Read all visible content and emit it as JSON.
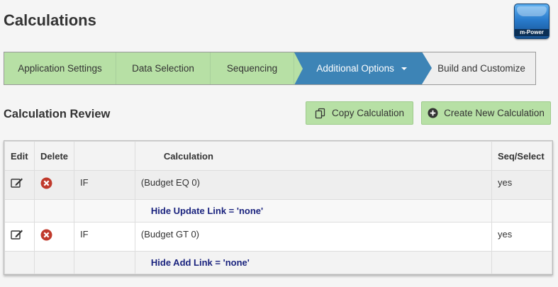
{
  "page": {
    "title": "Calculations"
  },
  "logo": {
    "text": "m-Power"
  },
  "wizard": {
    "steps": [
      {
        "label": "Application Settings"
      },
      {
        "label": "Data Selection"
      },
      {
        "label": "Sequencing"
      },
      {
        "label": "Additional Options"
      },
      {
        "label": "Build and Customize"
      }
    ],
    "active_index": 3
  },
  "section": {
    "title": "Calculation Review"
  },
  "buttons": {
    "copy": "Copy Calculation",
    "create": "Create New Calculation"
  },
  "table": {
    "headers": {
      "edit": "Edit",
      "delete": "Delete",
      "type": "",
      "calculation": "Calculation",
      "seq": "Seq/Select"
    },
    "rows": [
      {
        "type": "IF",
        "condition": "(Budget EQ 0)",
        "seq": "yes",
        "action": "Hide Update Link = 'none'"
      },
      {
        "type": "IF",
        "condition": "(Budget GT 0)",
        "seq": "yes",
        "action": "Hide Add Link = 'none'"
      }
    ]
  },
  "colors": {
    "wizard_done": "#b7e0a5",
    "wizard_active": "#3d84b6",
    "delete_icon": "#c0392b",
    "action_text": "#1a237e"
  }
}
